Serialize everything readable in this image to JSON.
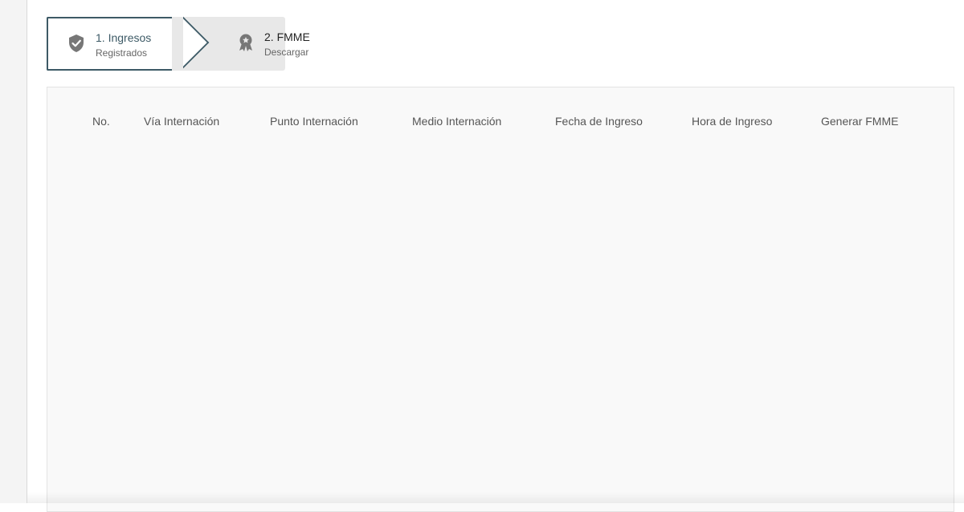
{
  "stepper": {
    "steps": [
      {
        "title": "1. Ingresos",
        "subtitle": "Registrados",
        "icon": "shield-check-icon",
        "active": true
      },
      {
        "title": "2. FMME",
        "subtitle": "Descargar",
        "icon": "award-ribbon-icon",
        "active": false
      }
    ]
  },
  "table": {
    "columns": [
      "No.",
      "Vía Internación",
      "Punto Internación",
      "Medio Internación",
      "Fecha de Ingreso",
      "Hora de Ingreso",
      "Generar FMME"
    ],
    "rows": []
  },
  "colors": {
    "accent": "#3d5a66",
    "inactive_step_bg": "#e8e8e8",
    "panel_bg": "#f9f9f9"
  }
}
